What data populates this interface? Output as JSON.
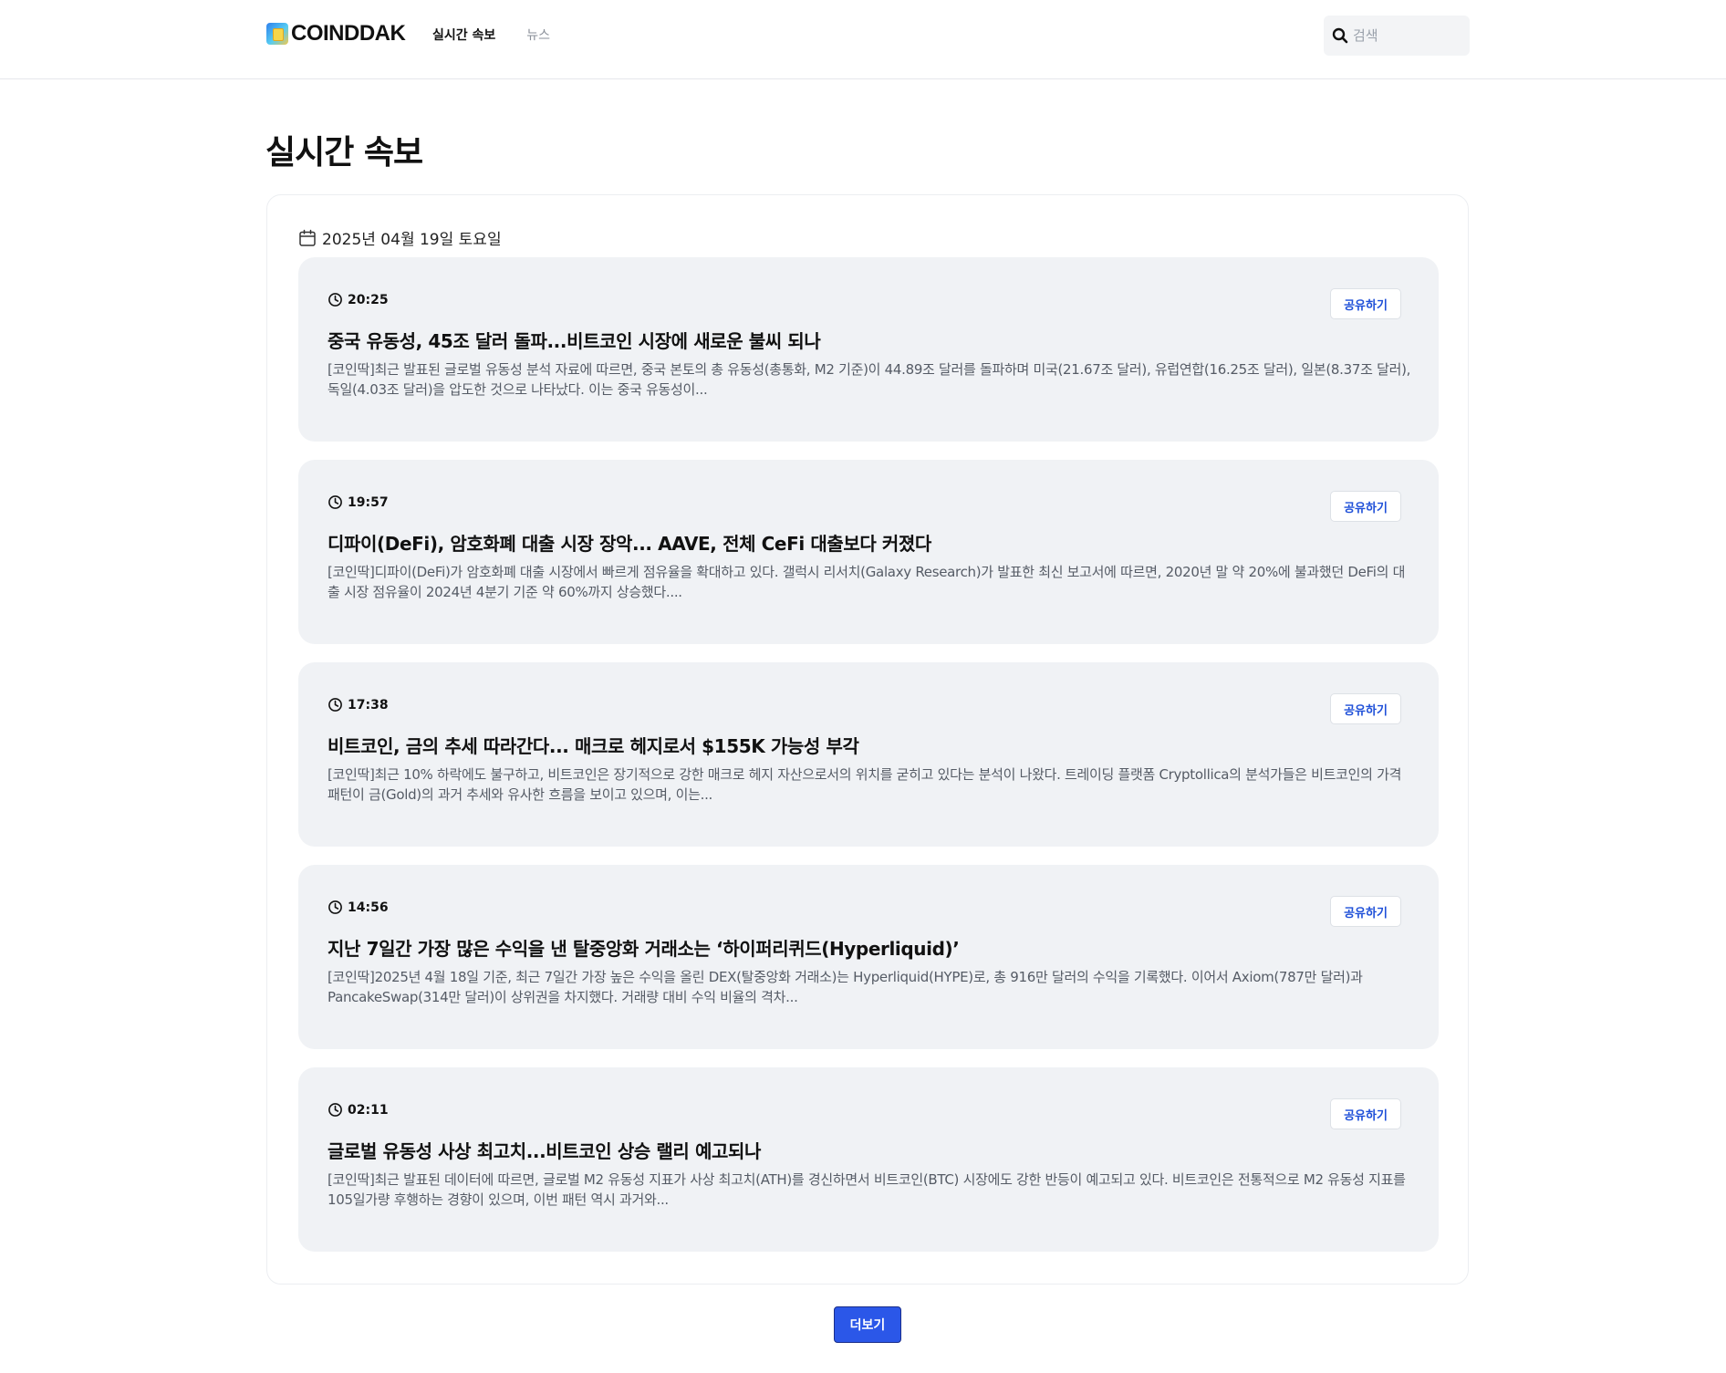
{
  "header": {
    "logo_text": "COINDDAK",
    "nav": [
      {
        "label": "실시간 속보",
        "active": true
      },
      {
        "label": "뉴스",
        "active": false
      }
    ],
    "search": {
      "placeholder": "검색",
      "value": ""
    }
  },
  "page_title": "실시간 속보",
  "date_label": "2025년 04월 19일 토요일",
  "share_label": "공유하기",
  "articles": [
    {
      "time": "20:25",
      "title": "중국 유동성, 45조 달러 돌파...비트코인 시장에 새로운 불씨 되나",
      "summary": "[코인딱]최근 발표된 글로벌 유동성 분석 자료에 따르면, 중국 본토의 총 유동성(총통화, M2 기준)이 44.89조 달러를 돌파하며 미국(21.67조 달러), 유럽연합(16.25조 달러), 일본(8.37조 달러), 독일(4.03조 달러)을 압도한 것으로 나타났다. 이는 중국 유동성이..."
    },
    {
      "time": "19:57",
      "title": "디파이(DeFi), 암호화폐 대출 시장 장악... AAVE, 전체 CeFi 대출보다 커졌다",
      "summary": "[코인딱]디파이(DeFi)가 암호화폐 대출 시장에서 빠르게 점유율을 확대하고 있다. 갤럭시 리서치(Galaxy Research)가 발표한 최신 보고서에 따르면, 2020년 말 약 20%에 불과했던 DeFi의 대출 시장 점유율이 2024년 4분기 기준 약 60%까지 상승했다...."
    },
    {
      "time": "17:38",
      "title": "비트코인, 금의 추세 따라간다... 매크로 헤지로서 $155K 가능성 부각",
      "summary": "[코인딱]최근 10% 하락에도 불구하고, 비트코인은 장기적으로 강한 매크로 헤지 자산으로서의 위치를 굳히고 있다는 분석이 나왔다. 트레이딩 플랫폼 Cryptollica의 분석가들은 비트코인의 가격 패턴이 금(Gold)의 과거 추세와 유사한 흐름을 보이고 있으며, 이는..."
    },
    {
      "time": "14:56",
      "title": "지난 7일간 가장 많은 수익을 낸 탈중앙화 거래소는 ‘하이퍼리퀴드(Hyperliquid)’",
      "summary": "[코인딱]2025년 4월 18일 기준, 최근 7일간 가장 높은 수익을 올린 DEX(탈중앙화 거래소)는 Hyperliquid(HYPE)로, 총 916만 달러의 수익을 기록했다. 이어서 Axiom(787만 달러)과 PancakeSwap(314만 달러)이 상위권을 차지했다. 거래량 대비 수익 비율의 격차..."
    },
    {
      "time": "02:11",
      "title": "글로벌 유동성 사상 최고치...비트코인 상승 랠리 예고되나",
      "summary": "[코인딱]최근 발표된 데이터에 따르면, 글로벌 M2 유동성 지표가 사상 최고치(ATH)를 경신하면서 비트코인(BTC) 시장에도 강한 반등이 예고되고 있다. 비트코인은 전통적으로 M2 유동성 지표를 105일가량 후행하는 경향이 있으며, 이번 패턴 역시 과거와..."
    }
  ],
  "more_label": "더보기",
  "colors": {
    "accent": "#2b57e8",
    "share_text": "#1e4fd8",
    "card_bg": "#f0f2f5"
  }
}
